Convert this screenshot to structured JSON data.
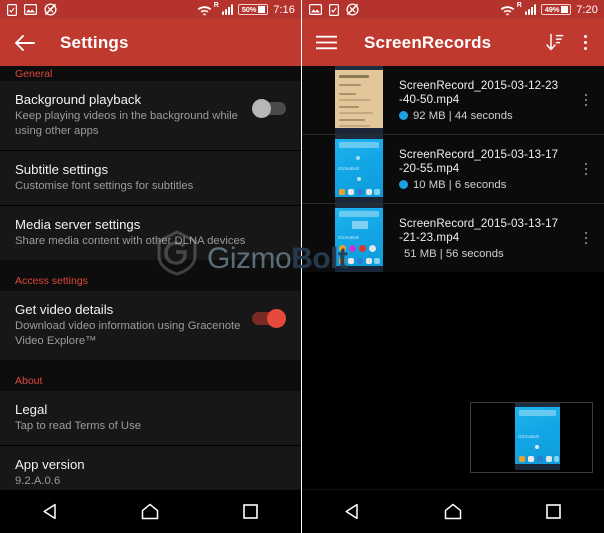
{
  "left": {
    "statusbar": {
      "icons": [
        "checkbox-icon",
        "image-icon",
        "no-sync-icon"
      ],
      "wifi": "wifi-icon",
      "roaming": "R",
      "signal": "signal-icon",
      "battery_percent": "50%",
      "time": "7:16"
    },
    "appbar": {
      "back_icon": "back-arrow-icon",
      "title": "Settings"
    },
    "sections": [
      {
        "header": "General",
        "rows": [
          {
            "title": "Background playback",
            "subtitle": "Keep playing videos in the background while using other apps",
            "switch": "off"
          }
        ]
      },
      {
        "header": "",
        "rows": [
          {
            "title": "Subtitle settings",
            "subtitle": "Customise font settings for subtitles",
            "switch": "none"
          }
        ]
      },
      {
        "header": "",
        "rows": [
          {
            "title": "Media server settings",
            "subtitle": "Share media content with other DLNA devices",
            "switch": "none"
          }
        ]
      },
      {
        "header": "Access settings",
        "rows": [
          {
            "title": "Get video details",
            "subtitle": "Download video information using Gracenote Video Explore™",
            "switch": "on"
          }
        ]
      },
      {
        "header": "About",
        "rows": [
          {
            "title": "Legal",
            "subtitle": "Tap to read Terms of Use",
            "switch": "none"
          }
        ]
      },
      {
        "header": "",
        "rows": [
          {
            "title": "App version",
            "subtitle": "9.2.A.0.6",
            "switch": "none"
          }
        ]
      }
    ]
  },
  "right": {
    "statusbar": {
      "icons": [
        "image-icon",
        "checkbox-icon",
        "no-sync-icon"
      ],
      "wifi": "wifi-icon",
      "roaming": "R",
      "signal": "signal-icon",
      "battery_percent": "49%",
      "time": "7:20"
    },
    "appbar": {
      "menu_icon": "hamburger-menu-icon",
      "title": "ScreenRecords",
      "sort_icon": "sort-descending-icon",
      "overflow_icon": "overflow-menu-icon"
    },
    "recordings": [
      {
        "name": "ScreenRecord_2015-03-12-23-40-50.mp4",
        "name_line1": "ScreenRecord_2015-03-12-23",
        "name_line2": "-40-50.mp4",
        "meta": "92 MB | 44 seconds",
        "size": "92 MB",
        "duration": "44 seconds",
        "has_badge": true,
        "thumb_style": "beige"
      },
      {
        "name": "ScreenRecord_2015-03-13-17-20-55.mp4",
        "name_line1": "ScreenRecord_2015-03-13-17",
        "name_line2": "-20-55.mp4",
        "meta": "10 MB | 6 seconds",
        "size": "10 MB",
        "duration": "6 seconds",
        "has_badge": true,
        "thumb_style": "blue"
      },
      {
        "name": "ScreenRecord_2015-03-13-17-21-23.mp4",
        "name_line1": "ScreenRecord_2015-03-13-17",
        "name_line2": "-21-23.mp4",
        "meta": "51 MB | 56 seconds",
        "size": "51 MB",
        "duration": "56 seconds",
        "has_badge": false,
        "thumb_style": "blue2"
      }
    ],
    "preview": {
      "label": "video-preview-thumbnail"
    }
  },
  "navbar": {
    "back": "back-triangle-icon",
    "home": "home-icon",
    "recents": "recents-square-icon"
  },
  "watermark": {
    "part1": "Gizmo",
    "part2": "Bolt"
  },
  "colors": {
    "appbar": "#c0392f",
    "statusbar": "#b4332c",
    "section_header": "#e0483c",
    "switch_on": "#e64a3b",
    "badge": "#1e9fe0"
  }
}
